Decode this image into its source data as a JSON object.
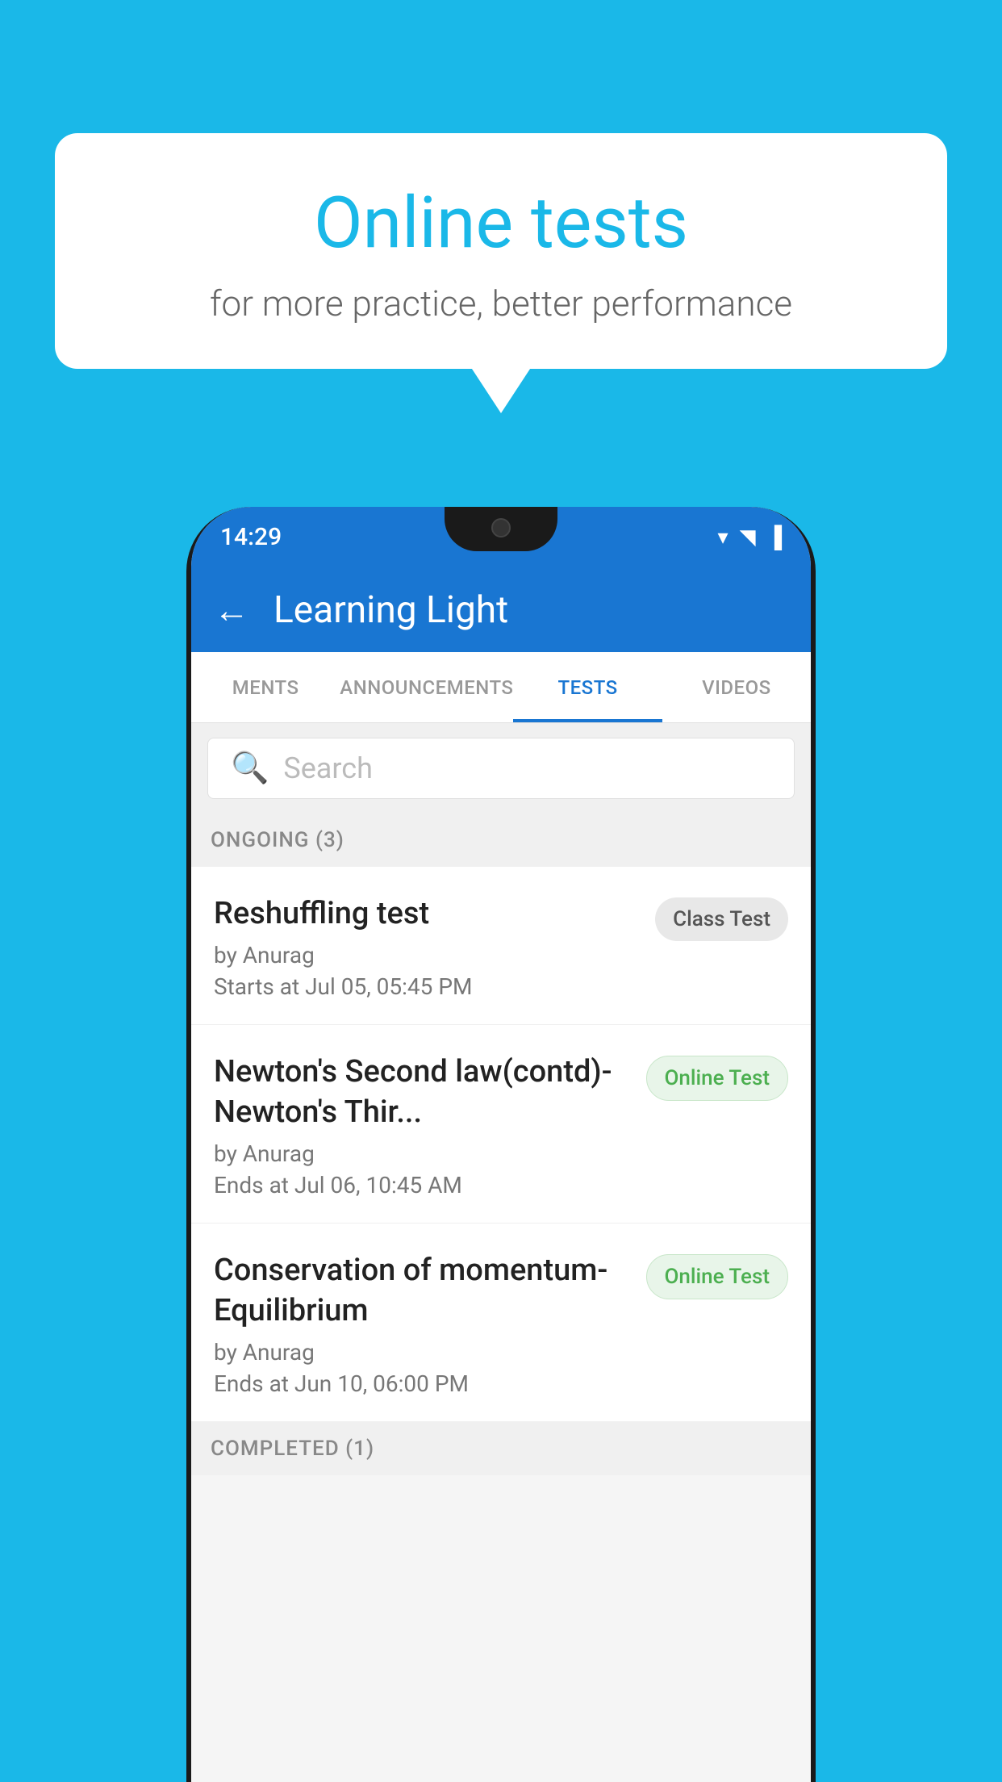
{
  "background": {
    "color": "#1ab8e8"
  },
  "speech_bubble": {
    "title": "Online tests",
    "subtitle": "for more practice, better performance"
  },
  "phone": {
    "status_bar": {
      "time": "14:29",
      "wifi_icon": "▾",
      "signal_icon": "▲",
      "battery_icon": "▐"
    },
    "app_bar": {
      "back_label": "←",
      "title": "Learning Light"
    },
    "tabs": [
      {
        "label": "MENTS",
        "active": false
      },
      {
        "label": "ANNOUNCEMENTS",
        "active": false
      },
      {
        "label": "TESTS",
        "active": true
      },
      {
        "label": "VIDEOS",
        "active": false
      }
    ],
    "search": {
      "placeholder": "Search"
    },
    "ongoing_section": {
      "header": "ONGOING (3)",
      "tests": [
        {
          "name": "Reshuffling test",
          "author": "by Anurag",
          "date_label": "Starts at",
          "date": "Jul 05, 05:45 PM",
          "badge": "Class Test",
          "badge_type": "class"
        },
        {
          "name": "Newton's Second law(contd)-Newton's Thir...",
          "author": "by Anurag",
          "date_label": "Ends at",
          "date": "Jul 06, 10:45 AM",
          "badge": "Online Test",
          "badge_type": "online"
        },
        {
          "name": "Conservation of momentum-Equilibrium",
          "author": "by Anurag",
          "date_label": "Ends at",
          "date": "Jun 10, 06:00 PM",
          "badge": "Online Test",
          "badge_type": "online"
        }
      ]
    },
    "completed_section": {
      "header": "COMPLETED (1)"
    }
  }
}
